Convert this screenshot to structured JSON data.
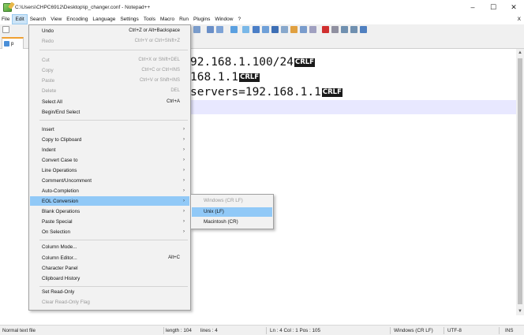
{
  "window": {
    "title": "C:\\Users\\CHPC6912\\Desktop\\ip_changer.conf - Notepad++",
    "minimize": "–",
    "maximize": "☐",
    "close": "✕"
  },
  "menubar": {
    "items": [
      "File",
      "Edit",
      "Search",
      "View",
      "Encoding",
      "Language",
      "Settings",
      "Tools",
      "Macro",
      "Run",
      "Plugins",
      "Window",
      "?"
    ],
    "close_doc": "X"
  },
  "tab": {
    "label": "p"
  },
  "editor": {
    "lines": [
      {
        "text": "92.168.1.100/24",
        "eol": "CRLF"
      },
      {
        "text": "168.1.1",
        "eol": "CRLF"
      },
      {
        "text": "servers=192.168.1.1",
        "eol": "CRLF"
      }
    ]
  },
  "edit_menu": {
    "items": [
      {
        "label": "Undo",
        "shortcut": "Ctrl+Z or Alt+Backspace",
        "enabled": true
      },
      {
        "label": "Redo",
        "shortcut": "Ctrl+Y or Ctrl+Shift+Z",
        "enabled": false
      },
      {
        "label": "Cut",
        "shortcut": "Ctrl+X or Shift+DEL",
        "enabled": false
      },
      {
        "label": "Copy",
        "shortcut": "Ctrl+C or Ctrl+INS",
        "enabled": false
      },
      {
        "label": "Paste",
        "shortcut": "Ctrl+V or Shift+INS",
        "enabled": false
      },
      {
        "label": "Delete",
        "shortcut": "DEL",
        "enabled": false
      },
      {
        "label": "Select All",
        "shortcut": "Ctrl+A",
        "enabled": true
      },
      {
        "label": "Begin/End Select",
        "shortcut": "",
        "enabled": true
      },
      {
        "label": "Insert",
        "submenu": true
      },
      {
        "label": "Copy to Clipboard",
        "submenu": true
      },
      {
        "label": "Indent",
        "submenu": true
      },
      {
        "label": "Convert Case to",
        "submenu": true
      },
      {
        "label": "Line Operations",
        "submenu": true
      },
      {
        "label": "Comment/Uncomment",
        "submenu": true
      },
      {
        "label": "Auto-Completion",
        "submenu": true
      },
      {
        "label": "EOL Conversion",
        "submenu": true,
        "highlighted": true
      },
      {
        "label": "Blank Operations",
        "submenu": true
      },
      {
        "label": "Paste Special",
        "submenu": true
      },
      {
        "label": "On Selection",
        "submenu": true
      },
      {
        "label": "Column Mode..."
      },
      {
        "label": "Column Editor...",
        "shortcut": "Alt+C"
      },
      {
        "label": "Character Panel"
      },
      {
        "label": "Clipboard History"
      },
      {
        "label": "Set Read-Only"
      },
      {
        "label": "Clear Read-Only Flag",
        "enabled": false
      }
    ],
    "submenu_arrow": "›"
  },
  "eol_submenu": {
    "items": [
      {
        "label": "Windows (CR LF)",
        "enabled": false
      },
      {
        "label": "Unix (LF)",
        "enabled": true,
        "highlighted": true
      },
      {
        "label": "Macintosh (CR)",
        "enabled": true
      }
    ]
  },
  "statusbar": {
    "file_type": "Normal text file",
    "length": "length : 104",
    "lines": "lines : 4",
    "position": "Ln : 4    Col : 1    Pos : 105",
    "eol": "Windows (CR LF)",
    "encoding": "UTF-8",
    "mode": "INS"
  },
  "colors": {
    "menu_highlight": "#91c9f7",
    "eol_badge_bg": "#1a1a1a",
    "current_line": "#e8e8ff",
    "tab_accent": "#f0a030"
  }
}
